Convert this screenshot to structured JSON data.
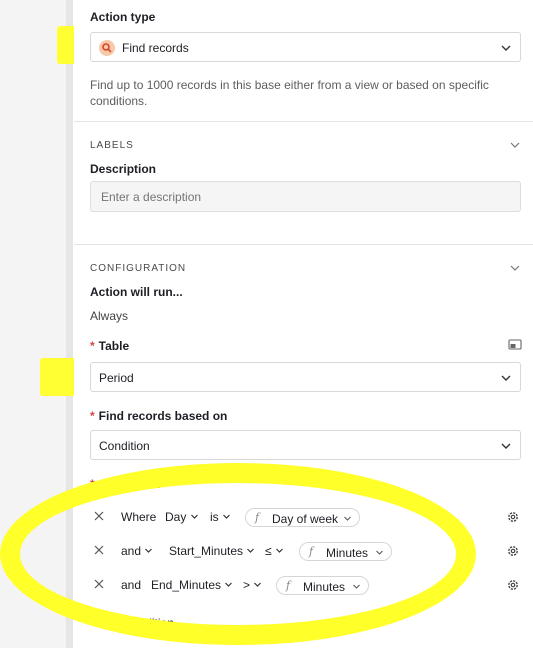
{
  "action_type": {
    "label": "Action type",
    "value": "Find records",
    "description": "Find up to 1000 records in this base either from a view or based on specific conditions."
  },
  "labels_section": {
    "title": "LABELS",
    "description_label": "Description",
    "description_placeholder": "Enter a description"
  },
  "configuration": {
    "title": "CONFIGURATION",
    "run_label": "Action will run...",
    "run_value": "Always",
    "table_label": "Table",
    "table_value": "Period",
    "find_label": "Find records based on",
    "find_value": "Condition",
    "conditions_label": "Conditions",
    "required_mark": "*",
    "conditions": [
      {
        "conj": "Where",
        "field": "Day",
        "op": "is",
        "value": "Day of week"
      },
      {
        "conj": "and",
        "field": "Start_Minutes",
        "op": "≤",
        "value": "Minutes"
      },
      {
        "conj": "and",
        "field": "End_Minutes",
        "op": ">",
        "value": "Minutes"
      }
    ],
    "add_condition": "Add condition",
    "add_icon": "+"
  },
  "colors": {
    "highlight": "#ffff33",
    "required": "#d64545",
    "search_icon_bg": "#f7c9a8",
    "search_icon_fg": "#d7452b"
  }
}
